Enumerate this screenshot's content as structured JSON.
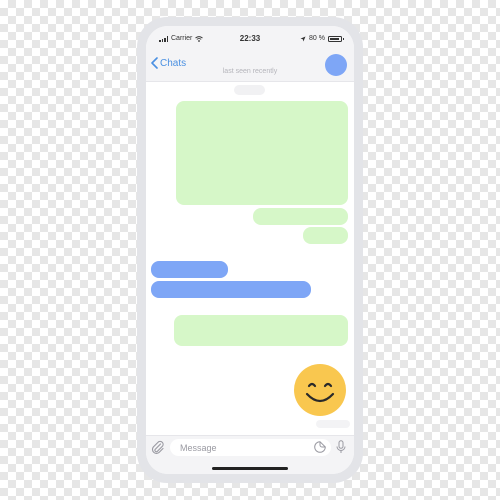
{
  "status": {
    "carrier": "Carrier",
    "time": "22:33",
    "battery": "80 %"
  },
  "header": {
    "back_label": "Chats",
    "subtitle": "last seen recently"
  },
  "chat": {
    "messages": [
      {
        "type": "outgoing-photo"
      },
      {
        "type": "outgoing"
      },
      {
        "type": "outgoing"
      },
      {
        "type": "incoming"
      },
      {
        "type": "incoming"
      },
      {
        "type": "outgoing"
      },
      {
        "type": "emoji",
        "icon": "smiley-face"
      }
    ]
  },
  "input": {
    "placeholder": "Message"
  },
  "colors": {
    "accent": "#4a90e2",
    "outgoing": "#d6f7c8",
    "incoming": "#7ea6f6",
    "emoji": "#f9c74f"
  }
}
